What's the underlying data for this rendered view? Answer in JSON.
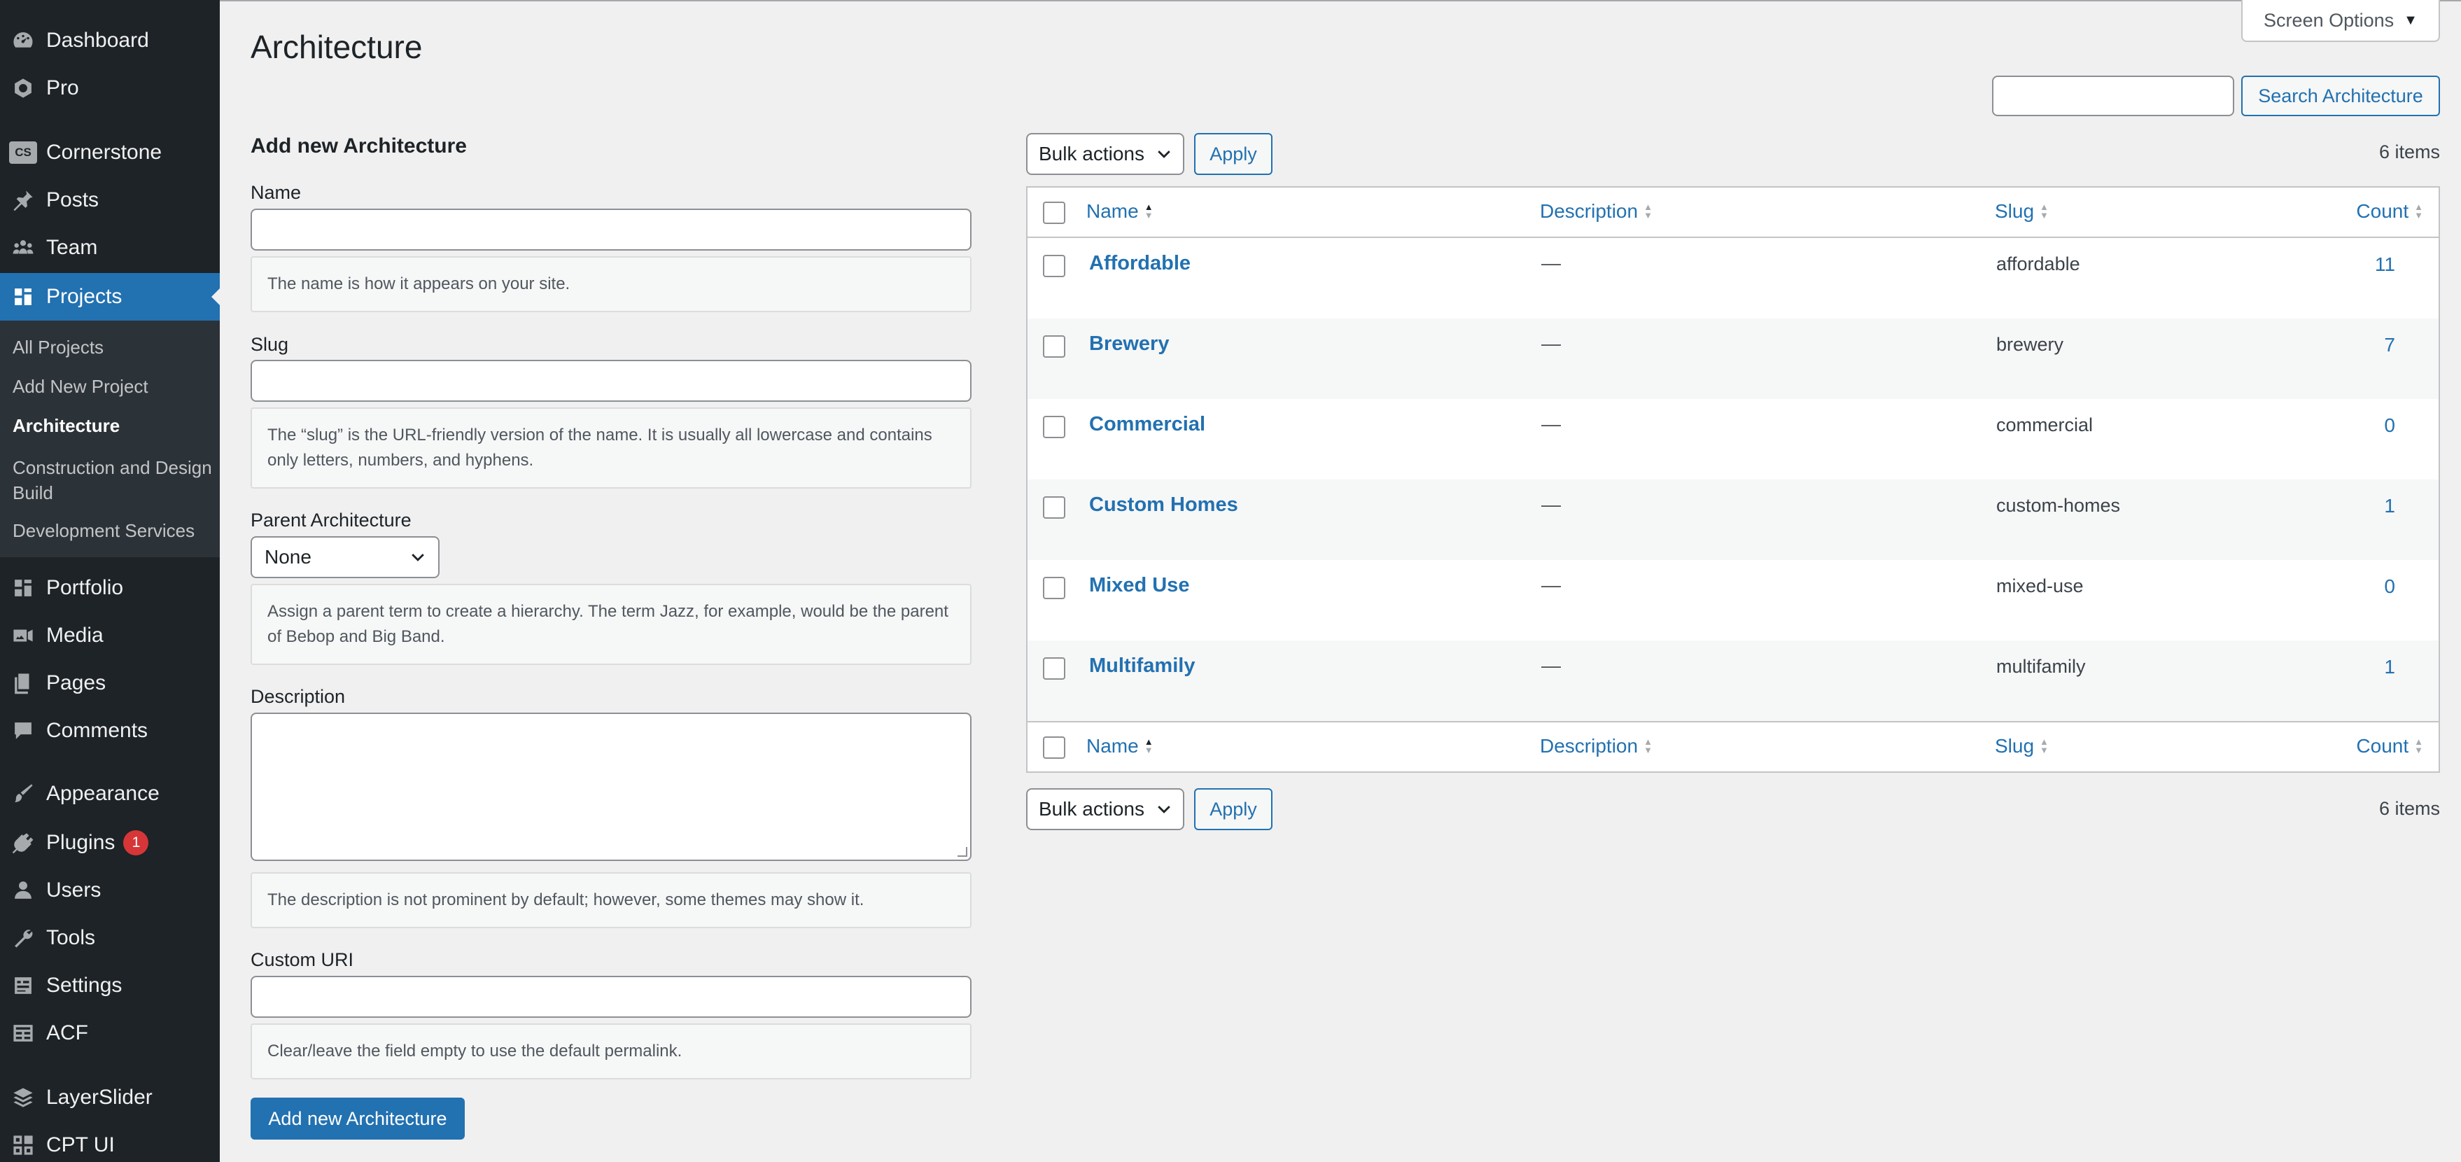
{
  "sidebar": {
    "menu": [
      {
        "label": "Dashboard",
        "icon": "dashboard-icon"
      },
      {
        "label": "Pro",
        "icon": "pro-icon"
      },
      {
        "label": "Cornerstone",
        "icon": "cornerstone-icon",
        "icon_text": "CS"
      },
      {
        "label": "Posts",
        "icon": "pushpin-icon"
      },
      {
        "label": "Team",
        "icon": "groups-icon"
      },
      {
        "label": "Projects",
        "icon": "portfolio-icon",
        "current": true
      },
      {
        "label": "Portfolio",
        "icon": "portfolio-icon"
      },
      {
        "label": "Media",
        "icon": "media-icon"
      },
      {
        "label": "Pages",
        "icon": "pages-icon"
      },
      {
        "label": "Comments",
        "icon": "comment-icon"
      },
      {
        "label": "Appearance",
        "icon": "paintbrush-icon"
      },
      {
        "label": "Plugins",
        "icon": "plugin-icon",
        "badge": "1"
      },
      {
        "label": "Users",
        "icon": "users-icon"
      },
      {
        "label": "Tools",
        "icon": "wrench-icon"
      },
      {
        "label": "Settings",
        "icon": "settings-icon"
      },
      {
        "label": "ACF",
        "icon": "acf-icon"
      },
      {
        "label": "LayerSlider",
        "icon": "layers-icon"
      },
      {
        "label": "CPT UI",
        "icon": "cpt-icon"
      }
    ],
    "submenu": [
      {
        "label": "All Projects"
      },
      {
        "label": "Add New Project"
      },
      {
        "label": "Architecture",
        "current": true
      },
      {
        "label": "Construction and Design Build"
      },
      {
        "label": "Development Services"
      }
    ]
  },
  "header": {
    "screen_options": "Screen Options",
    "page_title": "Architecture",
    "search_button": "Search Architecture",
    "search_value": ""
  },
  "form": {
    "heading": "Add new Architecture",
    "name_label": "Name",
    "name_value": "",
    "name_help": "The name is how it appears on your site.",
    "slug_label": "Slug",
    "slug_value": "",
    "slug_help": "The “slug” is the URL-friendly version of the name. It is usually all lowercase and contains only letters, numbers, and hyphens.",
    "parent_label": "Parent Architecture",
    "parent_selected": "None",
    "parent_help": "Assign a parent term to create a hierarchy. The term Jazz, for example, would be the parent of Bebop and Big Band.",
    "description_label": "Description",
    "description_value": "",
    "description_help": "The description is not prominent by default; however, some themes may show it.",
    "custom_uri_label": "Custom URI",
    "custom_uri_value": "",
    "custom_uri_help": "Clear/leave the field empty to use the default permalink.",
    "submit_label": "Add new Architecture"
  },
  "table": {
    "bulk_actions": "Bulk actions",
    "apply": "Apply",
    "items_count": "6 items",
    "columns": {
      "name": "Name",
      "description": "Description",
      "slug": "Slug",
      "count": "Count"
    },
    "sorted_by": "name",
    "rows": [
      {
        "name": "Affordable",
        "description": "—",
        "slug": "affordable",
        "count": "11"
      },
      {
        "name": "Brewery",
        "description": "—",
        "slug": "brewery",
        "count": "7"
      },
      {
        "name": "Commercial",
        "description": "—",
        "slug": "commercial",
        "count": "0"
      },
      {
        "name": "Custom Homes",
        "description": "—",
        "slug": "custom-homes",
        "count": "1"
      },
      {
        "name": "Mixed Use",
        "description": "—",
        "slug": "mixed-use",
        "count": "0"
      },
      {
        "name": "Multifamily",
        "description": "—",
        "slug": "multifamily",
        "count": "1"
      }
    ]
  },
  "colors": {
    "sidebar_bg": "#1d2327",
    "accent": "#2271b1",
    "badge": "#d63638",
    "page_bg": "#f0f0f1"
  }
}
